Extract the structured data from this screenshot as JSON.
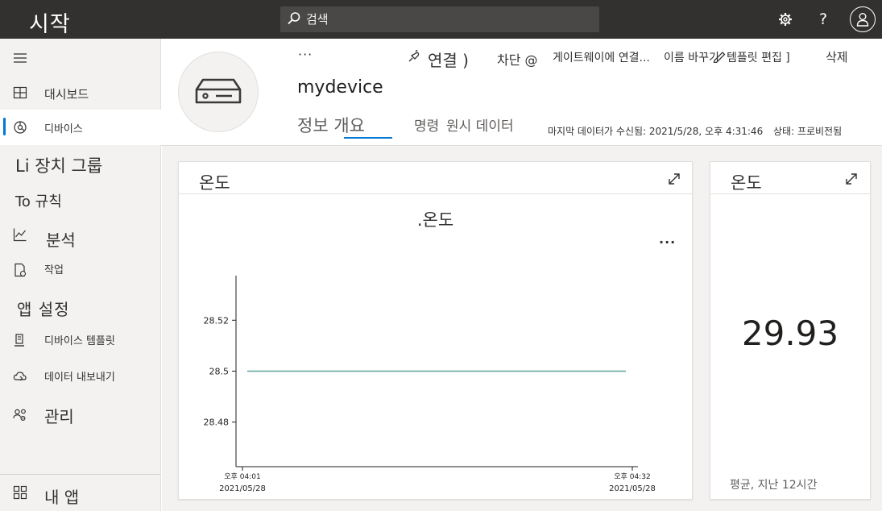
{
  "app": {
    "title": "시작"
  },
  "search": {
    "placeholder": "검색"
  },
  "topbar": {
    "settings_icon": "gear-icon",
    "help_label": "?",
    "user_icon": "avatar-icon"
  },
  "sidebar": {
    "items": [
      {
        "label": "대시보드",
        "icon": "dashboard-icon"
      },
      {
        "label": "디바이스",
        "icon": "devices-icon",
        "active": true
      },
      {
        "label": "Li 장치 그룹"
      },
      {
        "label": "To 규칙"
      },
      {
        "label": "분석",
        "icon": "analytics-icon"
      },
      {
        "label": "작업",
        "icon": "jobs-icon"
      },
      {
        "label": "앱 설정"
      },
      {
        "label": "디바이스 템플릿",
        "icon": "device-template-icon"
      },
      {
        "label": "데이터 내보내기",
        "icon": "data-export-icon"
      },
      {
        "label": "관리",
        "icon": "administration-icon"
      },
      {
        "label": "내 앱",
        "icon": "my-apps-icon"
      }
    ]
  },
  "device": {
    "name": "mydevice",
    "more_label": "···"
  },
  "commands": {
    "connect": "연결 )",
    "block": "차단 @",
    "gateway": "게이트웨이에 연결...",
    "rename": "이름 바꾸기",
    "edit_template": "템플릿 편집 ]",
    "delete": "삭제"
  },
  "tabs": {
    "overview": "정보 개요",
    "commands": "명령",
    "raw_data": "원시 데이터"
  },
  "status": {
    "last_received": "마지막 데이터가 수신됨: 2021/5/28, 오후 4:31:46",
    "state": "상태: 프로비전됨"
  },
  "tiles": {
    "chart_tile_title": "온도",
    "chart_more": "···",
    "kpi_tile_title": "온도",
    "kpi_value": "29.93",
    "kpi_footer": "평균, 지난 12시간"
  },
  "chart_data": {
    "type": "line",
    "title": ".온도",
    "x": [
      "2021/05/28 16:01",
      "2021/05/28 16:32"
    ],
    "x_tick_labels": [
      {
        "time": "오후 04:01",
        "date": "2021/05/28"
      },
      {
        "time": "오후 04:32",
        "date": "2021/05/28"
      }
    ],
    "y_ticks": [
      28.52,
      28.5,
      28.48
    ],
    "y_tick_labels": [
      "28.52",
      "28.5",
      "28.48"
    ],
    "ylim": [
      28.4625,
      28.5375
    ],
    "series": [
      {
        "values": [
          28.5,
          28.5
        ],
        "color": "#5aa69a"
      }
    ]
  }
}
